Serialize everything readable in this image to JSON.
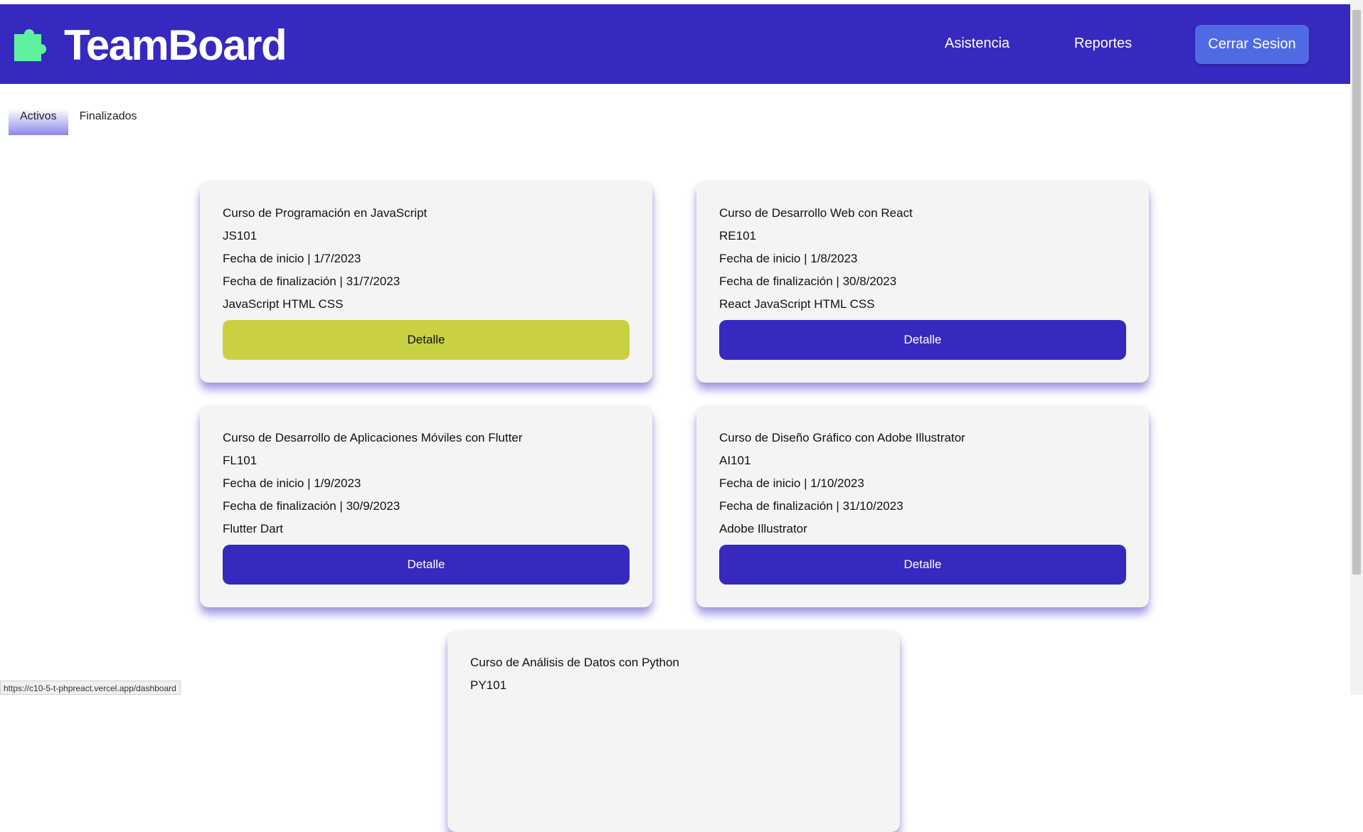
{
  "header": {
    "brand": "TeamBoard",
    "logo_icon": "puzzle-piece-icon",
    "nav": {
      "asistencia": "Asistencia",
      "reportes": "Reportes"
    },
    "logout_label": "Cerrar Sesion"
  },
  "tabs": [
    {
      "label": "Activos",
      "active": true
    },
    {
      "label": "Finalizados",
      "active": false
    }
  ],
  "courses": [
    {
      "title": "Curso de Programación en JavaScript",
      "code": "JS101",
      "start": "Fecha de inicio | 1/7/2023",
      "end": "Fecha de finalización | 31/7/2023",
      "tech": "JavaScript HTML CSS",
      "button": "Detalle"
    },
    {
      "title": "Curso de Desarrollo Web con React",
      "code": "RE101",
      "start": "Fecha de inicio | 1/8/2023",
      "end": "Fecha de finalización | 30/8/2023",
      "tech": "React JavaScript HTML CSS",
      "button": "Detalle"
    },
    {
      "title": "Curso de Desarrollo de Aplicaciones Móviles con Flutter",
      "code": "FL101",
      "start": "Fecha de inicio | 1/9/2023",
      "end": "Fecha de finalización | 30/9/2023",
      "tech": "Flutter Dart",
      "button": "Detalle"
    },
    {
      "title": "Curso de Diseño Gráfico con Adobe Illustrator",
      "code": "AI101",
      "start": "Fecha de inicio | 1/10/2023",
      "end": "Fecha de finalización | 31/10/2023",
      "tech": "Adobe Illustrator",
      "button": "Detalle"
    },
    {
      "title": "Curso de Análisis de Datos con Python",
      "code": "PY101"
    }
  ],
  "colors": {
    "primary": "#3629bf",
    "accent_logo": "#5ef2a0",
    "highlight_button": "#c9d143",
    "logout_button": "#4f6ae3"
  },
  "status_url": "https://c10-5-t-phpreact.vercel.app/dashboard"
}
